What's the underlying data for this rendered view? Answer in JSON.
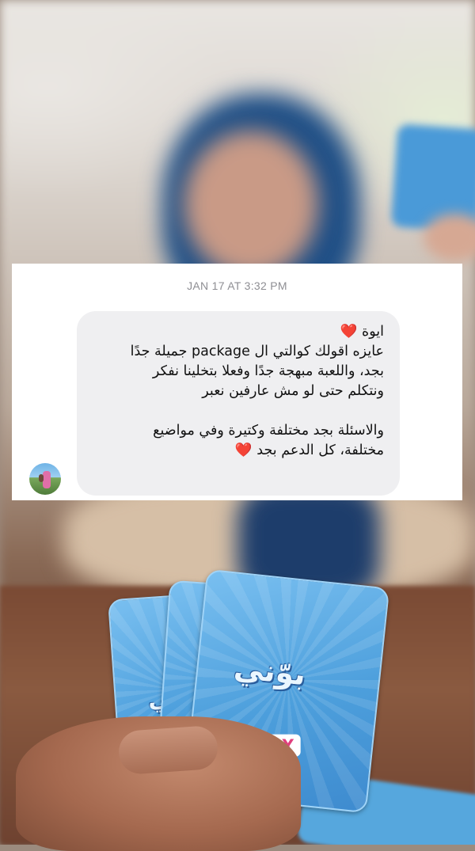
{
  "message": {
    "timestamp": "JAN 17 AT 3:32 PM",
    "lines": [
      "ايوة ❤️",
      "عايزه اقولك كوالتي ال package جميلة جدًا",
      "بجد، واللعبة مبهجة جدًا وفعلا بتخلينا نفكر",
      "ونتكلم حتى لو مش عارفين نعبر",
      "",
      "والاسئلة بجد مختلفة وكتيرة وفي مواضيع",
      "مختلفة، كل الدعم بجد ❤️"
    ]
  },
  "cards": {
    "title": "بوّني",
    "brand": "ZOLLY"
  },
  "colors": {
    "bubble": "#efeff1",
    "card_blue": "#4d9fdc",
    "brand_pink": "#e0407e",
    "heart": "#e0162b"
  }
}
